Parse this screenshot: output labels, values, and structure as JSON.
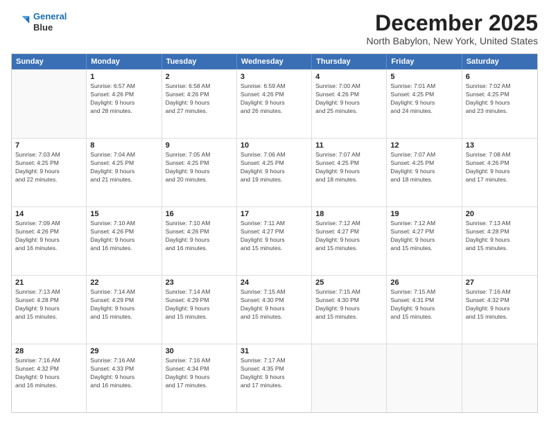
{
  "logo": {
    "line1": "General",
    "line2": "Blue"
  },
  "title": "December 2025",
  "subtitle": "North Babylon, New York, United States",
  "header_days": [
    "Sunday",
    "Monday",
    "Tuesday",
    "Wednesday",
    "Thursday",
    "Friday",
    "Saturday"
  ],
  "rows": [
    [
      {
        "day": "",
        "info": ""
      },
      {
        "day": "1",
        "info": "Sunrise: 6:57 AM\nSunset: 4:26 PM\nDaylight: 9 hours\nand 28 minutes."
      },
      {
        "day": "2",
        "info": "Sunrise: 6:58 AM\nSunset: 4:26 PM\nDaylight: 9 hours\nand 27 minutes."
      },
      {
        "day": "3",
        "info": "Sunrise: 6:59 AM\nSunset: 4:26 PM\nDaylight: 9 hours\nand 26 minutes."
      },
      {
        "day": "4",
        "info": "Sunrise: 7:00 AM\nSunset: 4:26 PM\nDaylight: 9 hours\nand 25 minutes."
      },
      {
        "day": "5",
        "info": "Sunrise: 7:01 AM\nSunset: 4:25 PM\nDaylight: 9 hours\nand 24 minutes."
      },
      {
        "day": "6",
        "info": "Sunrise: 7:02 AM\nSunset: 4:25 PM\nDaylight: 9 hours\nand 23 minutes."
      }
    ],
    [
      {
        "day": "7",
        "info": "Sunrise: 7:03 AM\nSunset: 4:25 PM\nDaylight: 9 hours\nand 22 minutes."
      },
      {
        "day": "8",
        "info": "Sunrise: 7:04 AM\nSunset: 4:25 PM\nDaylight: 9 hours\nand 21 minutes."
      },
      {
        "day": "9",
        "info": "Sunrise: 7:05 AM\nSunset: 4:25 PM\nDaylight: 9 hours\nand 20 minutes."
      },
      {
        "day": "10",
        "info": "Sunrise: 7:06 AM\nSunset: 4:25 PM\nDaylight: 9 hours\nand 19 minutes."
      },
      {
        "day": "11",
        "info": "Sunrise: 7:07 AM\nSunset: 4:25 PM\nDaylight: 9 hours\nand 18 minutes."
      },
      {
        "day": "12",
        "info": "Sunrise: 7:07 AM\nSunset: 4:25 PM\nDaylight: 9 hours\nand 18 minutes."
      },
      {
        "day": "13",
        "info": "Sunrise: 7:08 AM\nSunset: 4:26 PM\nDaylight: 9 hours\nand 17 minutes."
      }
    ],
    [
      {
        "day": "14",
        "info": "Sunrise: 7:09 AM\nSunset: 4:26 PM\nDaylight: 9 hours\nand 16 minutes."
      },
      {
        "day": "15",
        "info": "Sunrise: 7:10 AM\nSunset: 4:26 PM\nDaylight: 9 hours\nand 16 minutes."
      },
      {
        "day": "16",
        "info": "Sunrise: 7:10 AM\nSunset: 4:26 PM\nDaylight: 9 hours\nand 16 minutes."
      },
      {
        "day": "17",
        "info": "Sunrise: 7:11 AM\nSunset: 4:27 PM\nDaylight: 9 hours\nand 15 minutes."
      },
      {
        "day": "18",
        "info": "Sunrise: 7:12 AM\nSunset: 4:27 PM\nDaylight: 9 hours\nand 15 minutes."
      },
      {
        "day": "19",
        "info": "Sunrise: 7:12 AM\nSunset: 4:27 PM\nDaylight: 9 hours\nand 15 minutes."
      },
      {
        "day": "20",
        "info": "Sunrise: 7:13 AM\nSunset: 4:28 PM\nDaylight: 9 hours\nand 15 minutes."
      }
    ],
    [
      {
        "day": "21",
        "info": "Sunrise: 7:13 AM\nSunset: 4:28 PM\nDaylight: 9 hours\nand 15 minutes."
      },
      {
        "day": "22",
        "info": "Sunrise: 7:14 AM\nSunset: 4:29 PM\nDaylight: 9 hours\nand 15 minutes."
      },
      {
        "day": "23",
        "info": "Sunrise: 7:14 AM\nSunset: 4:29 PM\nDaylight: 9 hours\nand 15 minutes."
      },
      {
        "day": "24",
        "info": "Sunrise: 7:15 AM\nSunset: 4:30 PM\nDaylight: 9 hours\nand 15 minutes."
      },
      {
        "day": "25",
        "info": "Sunrise: 7:15 AM\nSunset: 4:30 PM\nDaylight: 9 hours\nand 15 minutes."
      },
      {
        "day": "26",
        "info": "Sunrise: 7:15 AM\nSunset: 4:31 PM\nDaylight: 9 hours\nand 15 minutes."
      },
      {
        "day": "27",
        "info": "Sunrise: 7:16 AM\nSunset: 4:32 PM\nDaylight: 9 hours\nand 15 minutes."
      }
    ],
    [
      {
        "day": "28",
        "info": "Sunrise: 7:16 AM\nSunset: 4:32 PM\nDaylight: 9 hours\nand 16 minutes."
      },
      {
        "day": "29",
        "info": "Sunrise: 7:16 AM\nSunset: 4:33 PM\nDaylight: 9 hours\nand 16 minutes."
      },
      {
        "day": "30",
        "info": "Sunrise: 7:16 AM\nSunset: 4:34 PM\nDaylight: 9 hours\nand 17 minutes."
      },
      {
        "day": "31",
        "info": "Sunrise: 7:17 AM\nSunset: 4:35 PM\nDaylight: 9 hours\nand 17 minutes."
      },
      {
        "day": "",
        "info": ""
      },
      {
        "day": "",
        "info": ""
      },
      {
        "day": "",
        "info": ""
      }
    ]
  ]
}
